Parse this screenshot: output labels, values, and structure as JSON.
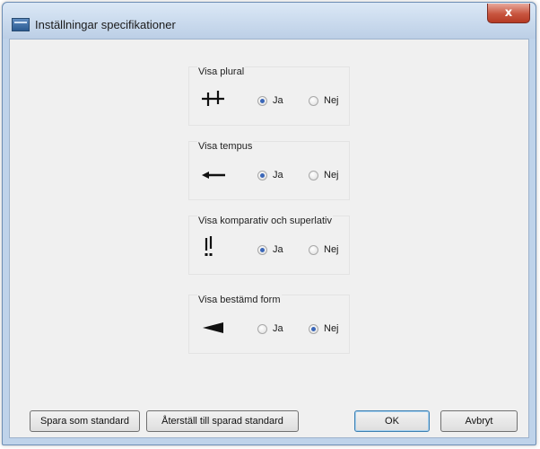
{
  "window": {
    "title": "Inställningar specifikationer",
    "close_label": "x"
  },
  "groups": [
    {
      "label": "Visa plural",
      "symbol": "plus-plus-icon",
      "ja": "Ja",
      "nej": "Nej",
      "selected": "ja"
    },
    {
      "label": "Visa tempus",
      "symbol": "arrow-left-icon",
      "ja": "Ja",
      "nej": "Nej",
      "selected": "ja"
    },
    {
      "label": "Visa komparativ och superlativ",
      "symbol": "double-exclamation-icon",
      "ja": "Ja",
      "nej": "Nej",
      "selected": "ja"
    },
    {
      "label": "Visa bestämd form",
      "symbol": "wedge-left-icon",
      "ja": "Ja",
      "nej": "Nej",
      "selected": "nej"
    }
  ],
  "buttons": {
    "save_default": "Spara som standard",
    "restore_default": "Återställ till sparad standard",
    "ok": "OK",
    "cancel": "Avbryt"
  }
}
